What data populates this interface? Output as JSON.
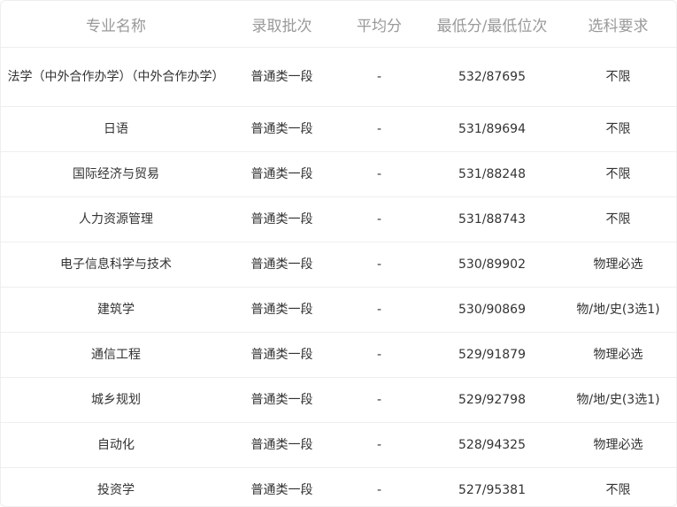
{
  "headers": [
    "专业名称",
    "录取批次",
    "平均分",
    "最低分/最低位次",
    "选科要求"
  ],
  "rows": [
    [
      "法学（中外合作办学）（中外合作办学）",
      "普通类一段",
      "-",
      "532/87695",
      "不限"
    ],
    [
      "日语",
      "普通类一段",
      "-",
      "531/89694",
      "不限"
    ],
    [
      "国际经济与贸易",
      "普通类一段",
      "-",
      "531/88248",
      "不限"
    ],
    [
      "人力资源管理",
      "普通类一段",
      "-",
      "531/88743",
      "不限"
    ],
    [
      "电子信息科学与技术",
      "普通类一段",
      "-",
      "530/89902",
      "物理必选"
    ],
    [
      "建筑学",
      "普通类一段",
      "-",
      "530/90869",
      "物/地/史(3选1)"
    ],
    [
      "通信工程",
      "普通类一段",
      "-",
      "529/91879",
      "物理必选"
    ],
    [
      "城乡规划",
      "普通类一段",
      "-",
      "529/92798",
      "物/地/史(3选1)"
    ],
    [
      "自动化",
      "普通类一段",
      "-",
      "528/94325",
      "物理必选"
    ],
    [
      "投资学",
      "普通类一段",
      "-",
      "527/95381",
      "不限"
    ]
  ]
}
